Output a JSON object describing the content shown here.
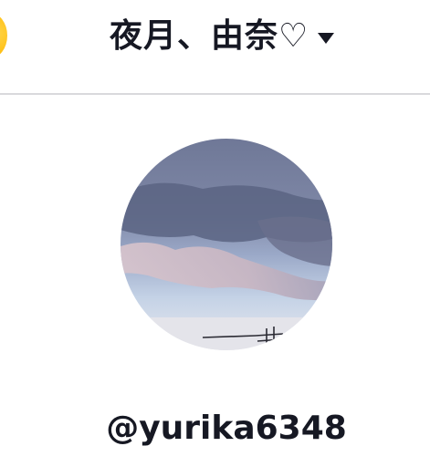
{
  "header": {
    "account_title": "夜月、由奈♡"
  },
  "profile": {
    "username": "@yurika6348"
  },
  "icons": {
    "coin": "coin-icon",
    "dropdown": "chevron-down-icon"
  },
  "colors": {
    "text": "#161823",
    "divider": "#d9d9dc",
    "coin": "#ffc21a"
  }
}
